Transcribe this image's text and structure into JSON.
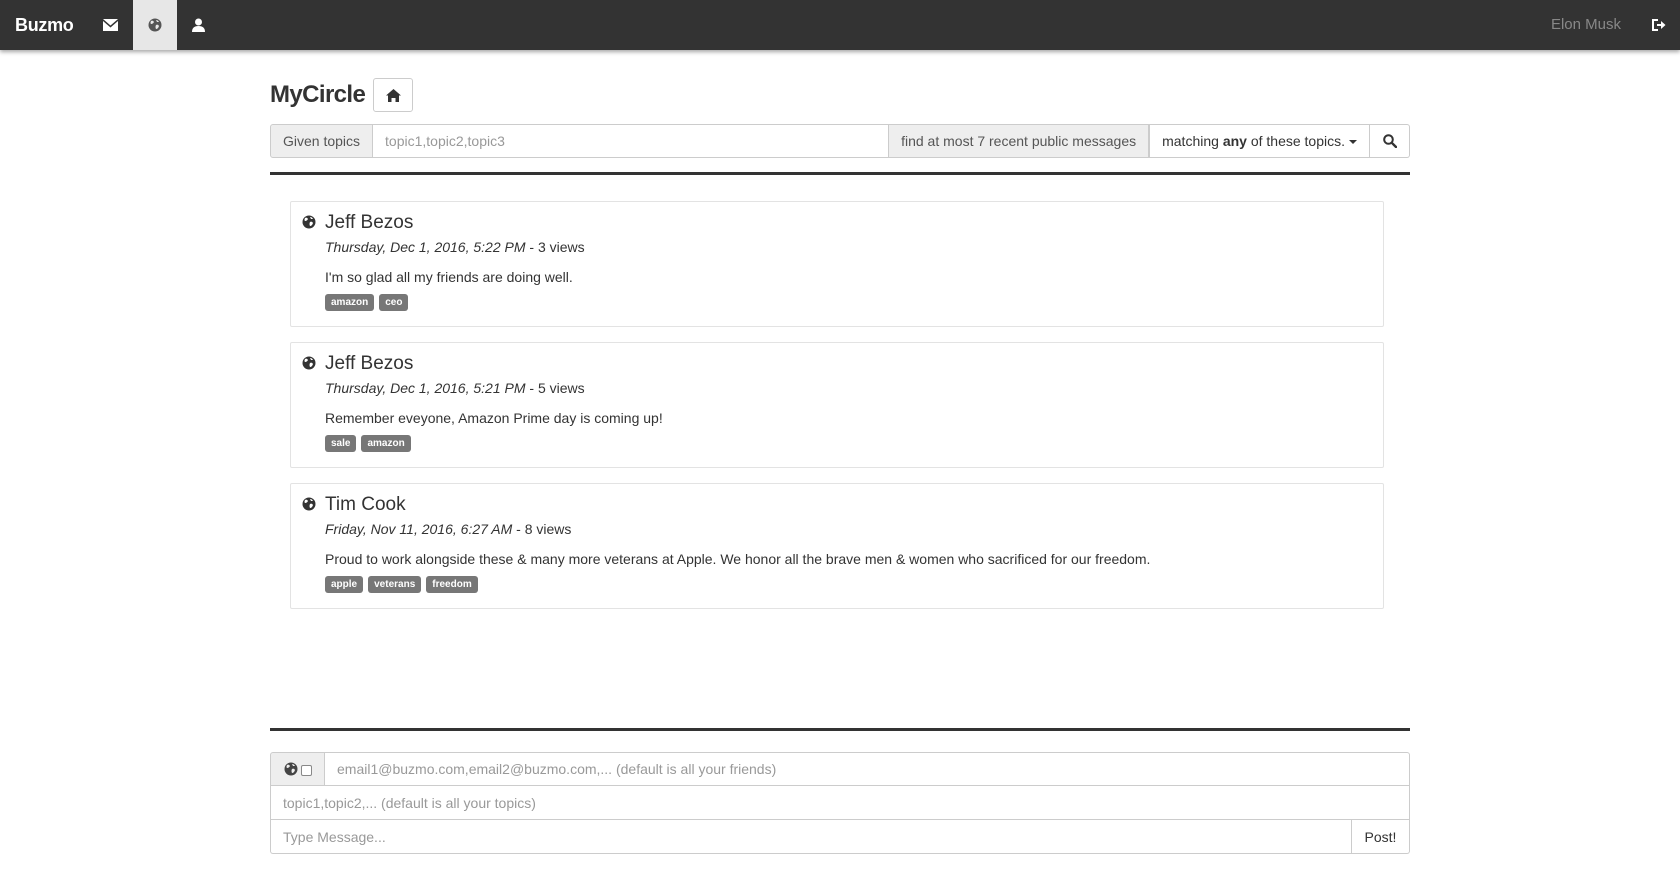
{
  "navbar": {
    "brand": "Buzmo",
    "icons": [
      "envelope-icon",
      "globe-icon",
      "user-icon"
    ],
    "active_icon": "globe-icon",
    "user_name": "Elon Musk",
    "logout_icon": "logout-icon"
  },
  "page": {
    "title": "MyCircle",
    "home_icon": "home-icon"
  },
  "search": {
    "given_label": "Given topics",
    "topics_placeholder": "topic1,topic2,topic3",
    "limit_label": "find at most 7 recent public messages",
    "match_prefix": "matching ",
    "match_mode": "any",
    "match_suffix": " of these topics.",
    "search_icon": "search-icon"
  },
  "messages": [
    {
      "author": "Jeff Bezos",
      "timestamp": "Thursday, Dec 1, 2016, 5:22 PM",
      "views": " - 3 views",
      "body": "I'm so glad all my friends are doing well.",
      "tags": [
        "amazon",
        "ceo"
      ],
      "visibility_icon": "globe-icon"
    },
    {
      "author": "Jeff Bezos",
      "timestamp": "Thursday, Dec 1, 2016, 5:21 PM",
      "views": " - 5 views",
      "body": "Remember eveyone, Amazon Prime day is coming up!",
      "tags": [
        "sale",
        "amazon"
      ],
      "visibility_icon": "globe-icon"
    },
    {
      "author": "Tim Cook",
      "timestamp": "Friday, Nov 11, 2016, 6:27 AM",
      "views": " - 8 views",
      "body": "Proud to work alongside these & many more veterans at Apple. We honor all the brave men & women who sacrificed for our freedom.",
      "tags": [
        "apple",
        "veterans",
        "freedom"
      ],
      "visibility_icon": "globe-icon"
    }
  ],
  "compose": {
    "recipients_placeholder": "email1@buzmo.com,email2@buzmo.com,... (default is all your friends)",
    "topics_placeholder": "topic1,topic2,... (default is all your topics)",
    "message_placeholder": "Type Message...",
    "post_label": "Post!",
    "public_checked": false
  }
}
